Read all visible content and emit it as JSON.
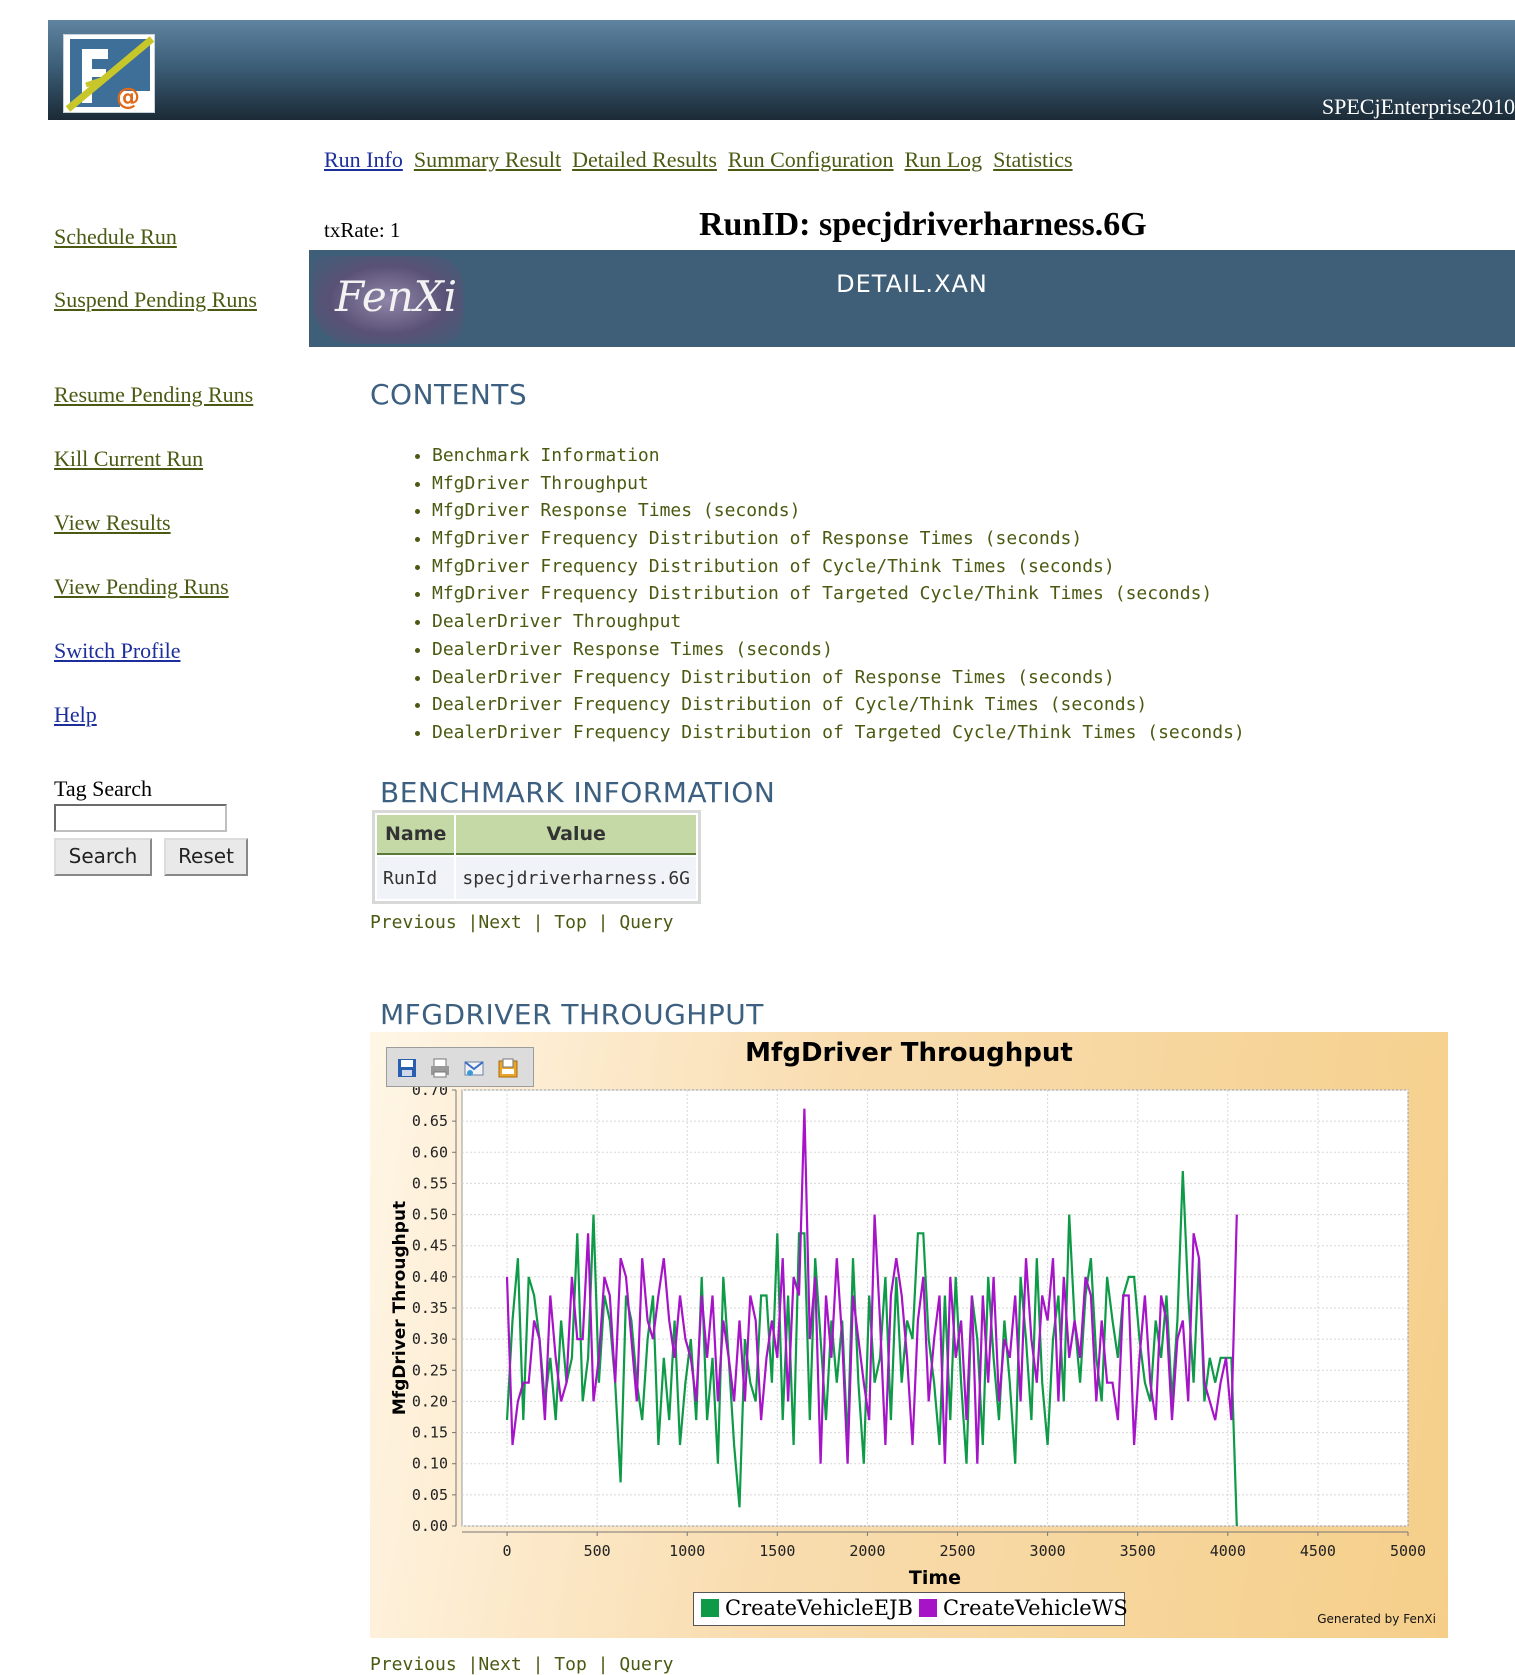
{
  "header": {
    "title": "SPECjEnterprise2010"
  },
  "tabs": [
    {
      "label": "Run Info",
      "active": true
    },
    {
      "label": "Summary Result"
    },
    {
      "label": "Detailed Results"
    },
    {
      "label": "Run Configuration"
    },
    {
      "label": "Run Log"
    },
    {
      "label": "Statistics"
    }
  ],
  "sidebar": {
    "links": [
      {
        "label": "Schedule Run"
      },
      {
        "label": "Suspend Pending Runs"
      },
      {
        "label": "Resume Pending Runs"
      },
      {
        "label": "Kill Current Run"
      },
      {
        "label": "View Results"
      },
      {
        "label": "View Pending Runs"
      },
      {
        "label": "Switch Profile"
      },
      {
        "label": "Help"
      }
    ],
    "tag_search_label": "Tag Search",
    "tag_search_value": "",
    "search_button": "Search",
    "reset_button": "Reset"
  },
  "run": {
    "txrate": "txRate: 1",
    "runid": "RunID: specjdriverharness.6G",
    "detail_title": "DETAIL.XAN",
    "logo_text": "FenXi"
  },
  "contents": {
    "heading": "CONTENTS",
    "items": [
      "Benchmark Information",
      "MfgDriver Throughput",
      "MfgDriver Response Times (seconds)",
      "MfgDriver Frequency Distribution of Response Times (seconds)",
      "MfgDriver Frequency Distribution of Cycle/Think Times (seconds)",
      "MfgDriver Frequency Distribution of Targeted Cycle/Think Times (seconds)",
      "DealerDriver Throughput",
      "DealerDriver Response Times (seconds)",
      "DealerDriver Frequency Distribution of Response Times (seconds)",
      "DealerDriver Frequency Distribution of Cycle/Think Times (seconds)",
      "DealerDriver Frequency Distribution of Targeted Cycle/Think Times (seconds)"
    ]
  },
  "benchmark": {
    "heading": "BENCHMARK INFORMATION",
    "columns": [
      "Name",
      "Value"
    ],
    "rows": [
      [
        "RunId",
        "specjdriverharness.6G"
      ]
    ]
  },
  "nav": {
    "previous": "Previous",
    "next": "Next",
    "top": "Top",
    "query": "Query",
    "sep": "|"
  },
  "throughput": {
    "heading": "MFGDRIVER THROUGHPUT",
    "generated": "Generated by FenXi"
  },
  "colors": {
    "ejb": "#0f9a48",
    "ws": "#a614c8",
    "link": "#4a5a12",
    "heading": "#3d6080"
  },
  "chart_data": {
    "type": "line",
    "title": "MfgDriver Throughput",
    "xlabel": "Time",
    "ylabel": "MfgDriver Throughput",
    "xlim": [
      -250,
      5000
    ],
    "ylim": [
      0,
      0.7
    ],
    "xticks": [
      0,
      500,
      1000,
      1500,
      2000,
      2500,
      3000,
      3500,
      4000,
      4500,
      5000
    ],
    "yticks": [
      0.0,
      0.05,
      0.1,
      0.15,
      0.2,
      0.25,
      0.3,
      0.35,
      0.4,
      0.45,
      0.5,
      0.55,
      0.6,
      0.65,
      0.7
    ],
    "yticklabels": [
      "0.00",
      "0.05",
      "0.10",
      "0.15",
      "0.20",
      "0.25",
      "0.30",
      "0.35",
      "0.40",
      "0.45",
      "0.50",
      "0.55",
      "0.60",
      "0.65",
      "0.70"
    ],
    "x_start": 0,
    "x_step": 30,
    "legend": "bottom",
    "grid": true,
    "series": [
      {
        "name": "CreateVehicleEJB",
        "color": "#0f9a48",
        "values": [
          0.17,
          0.33,
          0.43,
          0.17,
          0.4,
          0.37,
          0.3,
          0.2,
          0.27,
          0.17,
          0.33,
          0.23,
          0.27,
          0.47,
          0.2,
          0.27,
          0.5,
          0.23,
          0.37,
          0.33,
          0.23,
          0.07,
          0.37,
          0.33,
          0.23,
          0.17,
          0.3,
          0.37,
          0.13,
          0.27,
          0.17,
          0.33,
          0.13,
          0.23,
          0.3,
          0.17,
          0.4,
          0.17,
          0.27,
          0.1,
          0.4,
          0.27,
          0.13,
          0.03,
          0.3,
          0.23,
          0.2,
          0.37,
          0.37,
          0.23,
          0.47,
          0.17,
          0.37,
          0.13,
          0.47,
          0.47,
          0.17,
          0.43,
          0.3,
          0.17,
          0.33,
          0.23,
          0.33,
          0.13,
          0.43,
          0.23,
          0.1,
          0.37,
          0.23,
          0.27,
          0.4,
          0.17,
          0.4,
          0.23,
          0.33,
          0.3,
          0.47,
          0.47,
          0.3,
          0.23,
          0.13,
          0.37,
          0.17,
          0.4,
          0.23,
          0.1,
          0.37,
          0.3,
          0.13,
          0.4,
          0.27,
          0.17,
          0.33,
          0.23,
          0.1,
          0.4,
          0.3,
          0.17,
          0.43,
          0.23,
          0.13,
          0.3,
          0.37,
          0.2,
          0.5,
          0.33,
          0.23,
          0.37,
          0.43,
          0.27,
          0.2,
          0.4,
          0.33,
          0.27,
          0.37,
          0.4,
          0.4,
          0.3,
          0.23,
          0.2,
          0.33,
          0.27,
          0.37,
          0.2,
          0.33,
          0.57,
          0.37,
          0.23,
          0.43,
          0.2,
          0.27,
          0.23,
          0.27,
          0.27,
          0.27,
          0.0
        ]
      },
      {
        "name": "CreateVehicleWS",
        "color": "#a614c8",
        "values": [
          0.4,
          0.13,
          0.2,
          0.23,
          0.23,
          0.33,
          0.3,
          0.17,
          0.37,
          0.27,
          0.2,
          0.23,
          0.4,
          0.3,
          0.3,
          0.47,
          0.2,
          0.27,
          0.4,
          0.37,
          0.23,
          0.43,
          0.4,
          0.3,
          0.2,
          0.43,
          0.33,
          0.3,
          0.37,
          0.43,
          0.33,
          0.27,
          0.37,
          0.3,
          0.27,
          0.2,
          0.37,
          0.27,
          0.37,
          0.2,
          0.33,
          0.27,
          0.2,
          0.33,
          0.2,
          0.37,
          0.33,
          0.17,
          0.27,
          0.33,
          0.27,
          0.43,
          0.2,
          0.4,
          0.37,
          0.67,
          0.3,
          0.4,
          0.1,
          0.37,
          0.27,
          0.43,
          0.3,
          0.1,
          0.37,
          0.3,
          0.23,
          0.17,
          0.5,
          0.33,
          0.13,
          0.37,
          0.43,
          0.37,
          0.27,
          0.13,
          0.33,
          0.4,
          0.2,
          0.3,
          0.37,
          0.1,
          0.4,
          0.27,
          0.33,
          0.17,
          0.37,
          0.1,
          0.37,
          0.23,
          0.4,
          0.2,
          0.3,
          0.27,
          0.37,
          0.2,
          0.43,
          0.3,
          0.23,
          0.37,
          0.33,
          0.43,
          0.2,
          0.4,
          0.27,
          0.33,
          0.27,
          0.4,
          0.37,
          0.2,
          0.33,
          0.23,
          0.23,
          0.17,
          0.37,
          0.37,
          0.13,
          0.27,
          0.37,
          0.23,
          0.17,
          0.37,
          0.33,
          0.17,
          0.3,
          0.33,
          0.2,
          0.47,
          0.43,
          0.23,
          0.2,
          0.17,
          0.23,
          0.27,
          0.17,
          0.5
        ]
      }
    ]
  }
}
